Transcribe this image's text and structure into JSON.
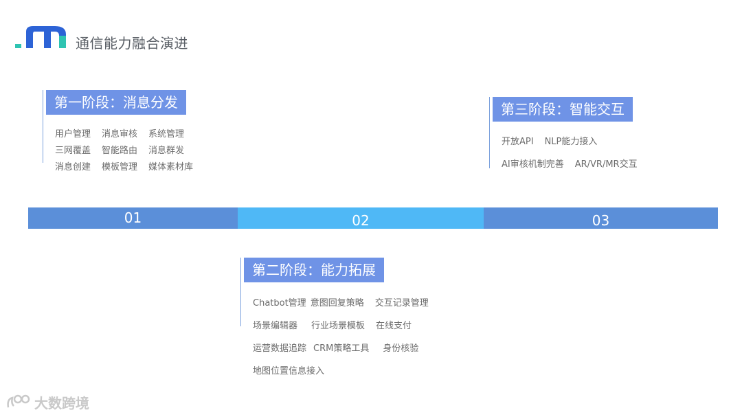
{
  "header": {
    "logo_text": ".m",
    "title": "通信能力融合演进"
  },
  "stages": [
    {
      "title": "第一阶段：消息分发",
      "rows": [
        [
          "用户管理",
          "消息审核",
          "系统管理"
        ],
        [
          "三网覆盖",
          "智能路由",
          "消息群发"
        ],
        [
          "消息创建",
          "模板管理",
          "媒体素材库"
        ]
      ]
    },
    {
      "title": "第二阶段：能力拓展",
      "rows": [
        [
          "Chatbot管理",
          "意图回复策略",
          "交互记录管理"
        ],
        [
          "场景编辑器",
          "行业场景模板",
          "在线支付"
        ],
        [
          "运营数据追踪",
          "CRM策略工具",
          "身份核验"
        ],
        [
          "地图位置信息接入"
        ]
      ]
    },
    {
      "title": "第三阶段：智能交互",
      "rows": [
        [
          "开放API",
          "NLP能力接入"
        ],
        [
          "AI审核机制完善",
          "AR/VR/MR交互"
        ]
      ]
    }
  ],
  "timeline": [
    "01",
    "02",
    "03"
  ],
  "colors": {
    "label_bg": "#6f93e6",
    "timeline_blue": "#5b8fd9",
    "timeline_light": "#4fb8f6",
    "logo_teal": "#2fc4b2",
    "logo_blue": "#2d63d6"
  },
  "watermark": "大数跨境"
}
